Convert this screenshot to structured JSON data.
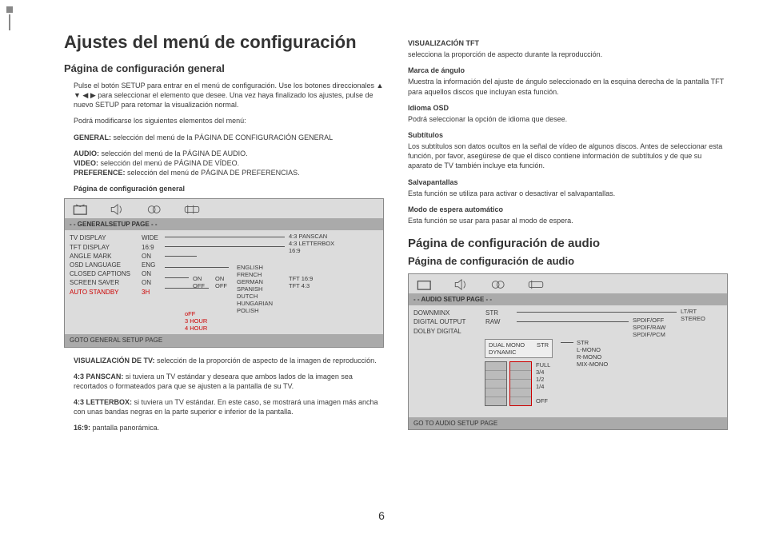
{
  "page_number": "6",
  "left": {
    "h1": "Ajustes del menú de configuración",
    "h2": "Página de configuración general",
    "intro": "Pulse el botón SETUP para entrar en el menú de configuración. Use los botones direccionales ▲ ▼ ◀ ▶ para seleccionar el elemento que desee. Una vez haya finalizado los ajustes, pulse de nuevo SETUP para retomar la visualización normal.",
    "intro2": "Podrá modificarse los siguientes elementos del menú:",
    "bullets": {
      "general_label": "GENERAL:",
      "general_text": " selección del menú de la PÁGINA DE CONFIGURACIÓN GENERAL",
      "audio_label": "AUDIO:",
      "audio_text": " selección del menú de la PÁGINA DE AUDIO.",
      "video_label": "VIDEO:",
      "video_text": " selección del menú de PÁGINA DE VÍDEO.",
      "pref_label": "PREFERENCE:",
      "pref_text": " selección del menú de PÁGINA DE PREFERENCIAS."
    },
    "sub_heading": "Página de configuración general",
    "menu": {
      "title": "- -  GENERALSETUP PAGE  - -",
      "items": [
        {
          "k": "TV DISPLAY",
          "v": "WIDE"
        },
        {
          "k": "TFT DISPLAY",
          "v": "16:9"
        },
        {
          "k": "ANGLE MARK",
          "v": "ON"
        },
        {
          "k": "OSD LANGUAGE",
          "v": "ENG"
        },
        {
          "k": "CLOSED CAPTIONS",
          "v": "ON"
        },
        {
          "k": "SCREEN SAVER",
          "v": "ON"
        },
        {
          "k": "AUTO STANDBY",
          "v": "3H",
          "red": true
        }
      ],
      "red_sub": [
        "oFF",
        "3 HOUR",
        "4 HOUR"
      ],
      "lang_list": [
        "ENGLISH",
        "FRENCH",
        "GERMAN",
        "SPANISH",
        "DUTCH",
        "HUNGARIAN",
        "POLISH"
      ],
      "onoff_pairs": [
        "ON",
        "OFF",
        "ON",
        "OFF"
      ],
      "tft_opts": [
        "TFT 16:9",
        "TFT 4:3"
      ],
      "wide_opts": [
        "4:3 PANSCAN",
        "4:3 LETTERBOX",
        "16:9"
      ],
      "footer": "GOTO GENERAL SETUP PAGE"
    },
    "tv_h": "VISUALIZACIÓN DE TV:",
    "tv_t": " selección de la proporción de aspecto de la imagen de reproducción.",
    "panscan_h": "4:3 PANSCAN:",
    "panscan_t": " si tuviera un TV estándar y deseara que ambos lados de la imagen sea recortados o formateados para que se ajusten a la pantalla de su TV.",
    "letter_h": "4:3 LETTERBOX:",
    "letter_t": " si tuviera un TV estándar. En este caso, se mostrará una imagen más ancha con unas bandas negras en la parte superior e inferior de la pantalla.",
    "w169_h": "16:9:",
    "w169_t": " pantalla panorámica."
  },
  "right": {
    "tft_h": "VISUALIZACIÓN TFT",
    "tft_t": "selecciona la proporción de aspecto durante la reproducción.",
    "ang_h": "Marca de ángulo",
    "ang_t": "Muestra la información del ajuste de ángulo seleccionado en la esquina derecha de la pantalla TFT para aquellos discos que incluyan esta función.",
    "osd_h": "Idioma OSD",
    "osd_t": "Podrá seleccionar la opción de idioma que desee.",
    "sub_h": "Subtítulos",
    "sub_t": "Los subtítulos son datos ocultos en la señal de vídeo de algunos discos. Antes de seleccionar esta función, por favor, asegúrese de que el disco contiene información de subtítulos y de que su aparato de TV también incluye eta función.",
    "scr_h": "Salvapantallas",
    "scr_t": "Esta función se utiliza para activar o desactivar el salvapantallas.",
    "stb_h": "Modo de espera automático",
    "stb_t": "Esta función se usar para pasar al modo de espera.",
    "h3": "Página de configuración de audio",
    "h2": "Página de configuración de audio",
    "menu": {
      "title": "- -  AUDIO SETUP PAGE  - -",
      "items": [
        {
          "k": "DOWNMINX",
          "v": "STR"
        },
        {
          "k": "DIGITAL OUTPUT",
          "v": "RAW"
        },
        {
          "k": "DOLBY DIGITAL",
          "v": ""
        }
      ],
      "dolby": [
        "DUAL MONO",
        "DYNAMIC"
      ],
      "dolby_v": "STR",
      "mono": [
        "STR",
        "L-MONO",
        "R-MONO",
        "MIX-MONO"
      ],
      "spdif": [
        "SPDIF/OFF",
        "SPDIF/RAW",
        "SPDIF/PCM"
      ],
      "ltrt": [
        "LT/RT",
        "STEREO"
      ],
      "scale": [
        "FULL",
        "3/4",
        "1/2",
        "1/4",
        "OFF"
      ],
      "footer": "GO TO AUDIO SETUP PAGE"
    }
  }
}
